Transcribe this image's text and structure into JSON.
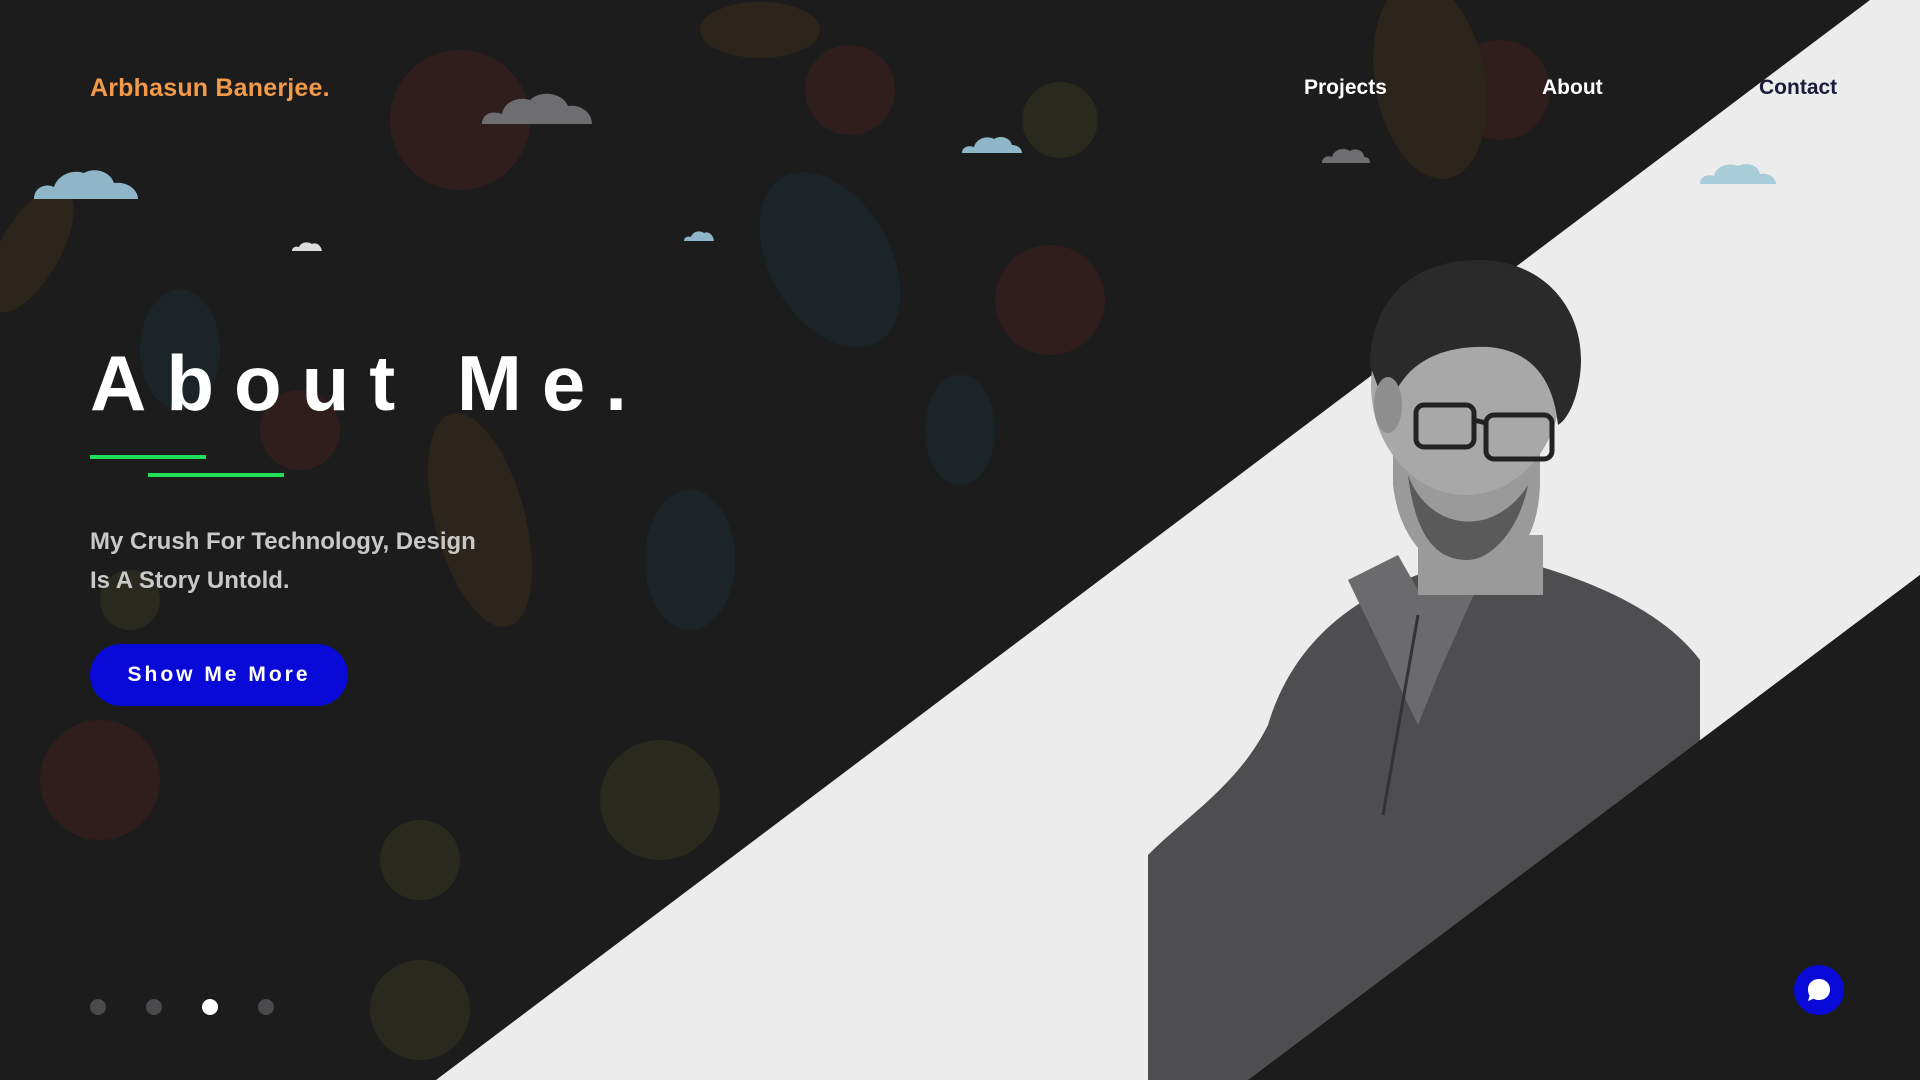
{
  "brand": {
    "name": "Arbhasun Banerjee."
  },
  "nav": [
    {
      "label": "Projects"
    },
    {
      "label": "About"
    },
    {
      "label": "Contact"
    }
  ],
  "hero": {
    "title": "About Me.",
    "tagline_lines": [
      "My Crush For Technology, Design",
      "Is A Story Untold."
    ],
    "cta_label": "Show Me More"
  },
  "slider": {
    "count": 4,
    "active_index": 2
  },
  "icons": {
    "chat": "chat-bubble-icon",
    "clouds": "cloud-icon"
  },
  "colors": {
    "background": "#1c1c1d",
    "panel": "#ececec",
    "brand": "#f2994a",
    "accent_blue": "#0a0ad8",
    "accent_green": "#20e05a",
    "text_light": "#ffffff",
    "text_muted": "#c9c9c9",
    "contact_text": "#1b1b3a"
  }
}
